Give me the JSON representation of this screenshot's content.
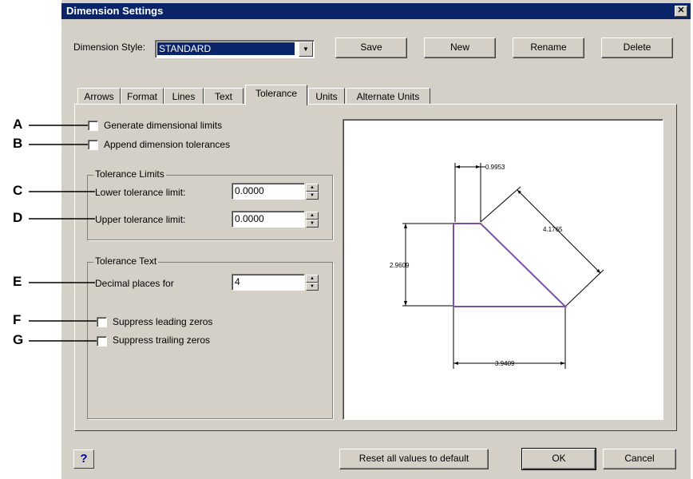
{
  "window": {
    "title": "Dimension Settings",
    "close_glyph": "✕"
  },
  "style_row": {
    "label": "Dimension Style:",
    "value": "STANDARD",
    "save": "Save",
    "new": "New",
    "rename": "Rename",
    "delete": "Delete"
  },
  "tabs": [
    "Arrows",
    "Format",
    "Lines",
    "Text",
    "Tolerance",
    "Units",
    "Alternate Units"
  ],
  "active_tab": "Tolerance",
  "options": {
    "generate_limits": {
      "label": "Generate dimensional limits",
      "checked": false
    },
    "append_tolerances": {
      "label": "Append dimension tolerances",
      "checked": false
    }
  },
  "tolerance_limits": {
    "title": "Tolerance Limits",
    "lower_label": "Lower tolerance limit:",
    "lower_value": "0.0000",
    "upper_label": "Upper tolerance limit:",
    "upper_value": "0.0000"
  },
  "tolerance_text": {
    "title": "Tolerance Text",
    "decimal_label": "Decimal places for",
    "decimal_value": "4",
    "suppress_leading": {
      "label": "Suppress leading zeros",
      "checked": false
    },
    "suppress_trailing": {
      "label": "Suppress trailing zeros",
      "checked": false
    }
  },
  "preview": {
    "dim_top": "0.9953",
    "dim_diag": "4.1765",
    "dim_left": "2.9609",
    "dim_bottom": "3.9409"
  },
  "footer": {
    "help": "?",
    "reset": "Reset all values to default",
    "ok": "OK",
    "cancel": "Cancel"
  },
  "callouts": [
    "A",
    "B",
    "C",
    "D",
    "E",
    "F",
    "G"
  ],
  "colors": {
    "titlebar": "#0a246a",
    "face": "#d4d0c8",
    "shape": "#7b4fa8"
  }
}
